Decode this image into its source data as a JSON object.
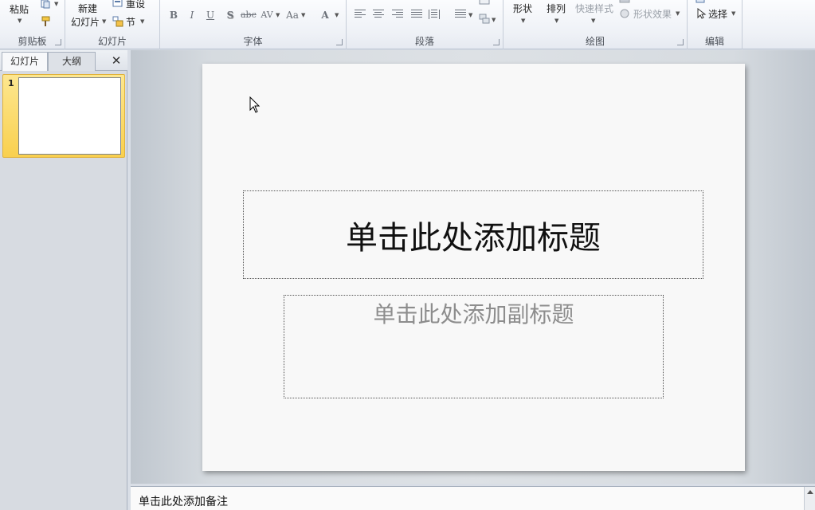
{
  "ribbon": {
    "clipboard": {
      "label": "剪贴板",
      "paste": "粘贴"
    },
    "slides": {
      "label": "幻灯片",
      "new_top": "新建",
      "new_bottom": "幻灯片",
      "reset": "重设",
      "section": "节"
    },
    "font": {
      "label": "字体",
      "buttons": [
        "B",
        "I",
        "U",
        "S",
        "abc",
        "AV",
        "Aa",
        "A"
      ]
    },
    "paragraph": {
      "label": "段落"
    },
    "drawing": {
      "label": "绘图",
      "shapes": "形状",
      "arrange": "排列",
      "quick_styles": "快速样式",
      "shape_effects": "形状效果"
    },
    "editing": {
      "label": "编辑",
      "select": "选择"
    }
  },
  "left_panel": {
    "tabs": [
      "幻灯片",
      "大纲"
    ],
    "close_glyph": "✕",
    "slides": [
      {
        "number": "1"
      }
    ]
  },
  "slide": {
    "title_placeholder": "单击此处添加标题",
    "subtitle_placeholder": "单击此处添加副标题"
  },
  "notes": {
    "placeholder": "单击此处添加备注"
  },
  "colors": {
    "selected_thumb": "#f9d04f",
    "ribbon_bg": "#eef1f6"
  }
}
